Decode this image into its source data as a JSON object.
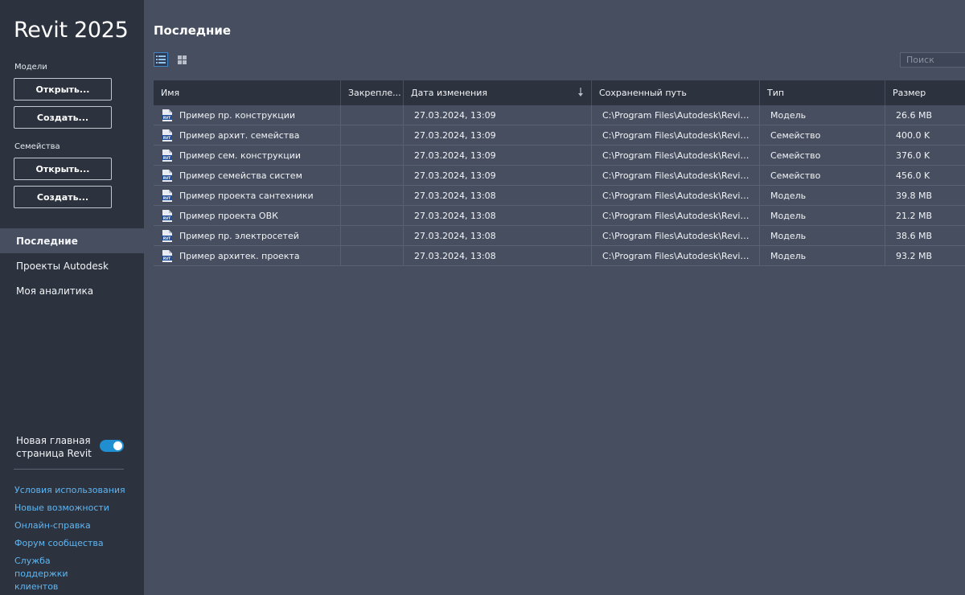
{
  "app": {
    "title": "Revit 2025"
  },
  "sidebar": {
    "models": {
      "label": "Модели",
      "open": "Открыть...",
      "create": "Создать..."
    },
    "families": {
      "label": "Семейства",
      "open": "Открыть...",
      "create": "Создать..."
    },
    "nav": [
      {
        "label": "Последние",
        "active": true
      },
      {
        "label": "Проекты Autodesk",
        "active": false
      },
      {
        "label": "Моя аналитика",
        "active": false
      }
    ],
    "toggle": {
      "label": "Новая главная страница Revit",
      "on": true
    },
    "links": [
      "Условия использования",
      "Новые возможности",
      "Онлайн-справка",
      "Форум сообщества",
      "Служба поддержки клиентов"
    ]
  },
  "main": {
    "title": "Последние",
    "view": {
      "selected": "list",
      "icons": [
        "list-view-icon",
        "grid-view-icon"
      ]
    },
    "search": {
      "placeholder": "Поиск",
      "value": ""
    },
    "table": {
      "columns": {
        "name": "Имя",
        "pinned": "Закрепле...",
        "date": "Дата изменения",
        "path": "Сохраненный путь",
        "type": "Тип",
        "size": "Размер"
      },
      "sort_column": "date",
      "sort_direction": "descending",
      "rows": [
        {
          "name": "Пример пр. конструкции",
          "date": "27.03.2024, 13:09",
          "path": "C:\\Program Files\\Autodesk\\Revit 2...",
          "type": "Модель",
          "size": "26.6 MB"
        },
        {
          "name": "Пример архит. семейства",
          "date": "27.03.2024, 13:09",
          "path": "C:\\Program Files\\Autodesk\\Revit 2...",
          "type": "Семейство",
          "size": "400.0 K"
        },
        {
          "name": "Пример сем. конструкции",
          "date": "27.03.2024, 13:09",
          "path": "C:\\Program Files\\Autodesk\\Revit 2...",
          "type": "Семейство",
          "size": "376.0 K"
        },
        {
          "name": "Пример семейства систем",
          "date": "27.03.2024, 13:09",
          "path": "C:\\Program Files\\Autodesk\\Revit 2...",
          "type": "Семейство",
          "size": "456.0 K"
        },
        {
          "name": "Пример проекта сантехники",
          "date": "27.03.2024, 13:08",
          "path": "C:\\Program Files\\Autodesk\\Revit 2...",
          "type": "Модель",
          "size": "39.8 MB"
        },
        {
          "name": "Пример проекта ОВК",
          "date": "27.03.2024, 13:08",
          "path": "C:\\Program Files\\Autodesk\\Revit 2...",
          "type": "Модель",
          "size": "21.2 MB"
        },
        {
          "name": "Пример пр. электросетей",
          "date": "27.03.2024, 13:08",
          "path": "C:\\Program Files\\Autodesk\\Revit 2...",
          "type": "Модель",
          "size": "38.6 MB"
        },
        {
          "name": "Пример архитек. проекта",
          "date": "27.03.2024, 13:08",
          "path": "C:\\Program Files\\Autodesk\\Revit 2...",
          "type": "Модель",
          "size": "93.2 MB"
        }
      ]
    }
  },
  "colors": {
    "sidebar_bg": "#2c323e",
    "main_bg": "#464e5f",
    "link": "#5fb7f4",
    "toggle_on": "#1f8fd1",
    "accent": "#3a86c8"
  }
}
